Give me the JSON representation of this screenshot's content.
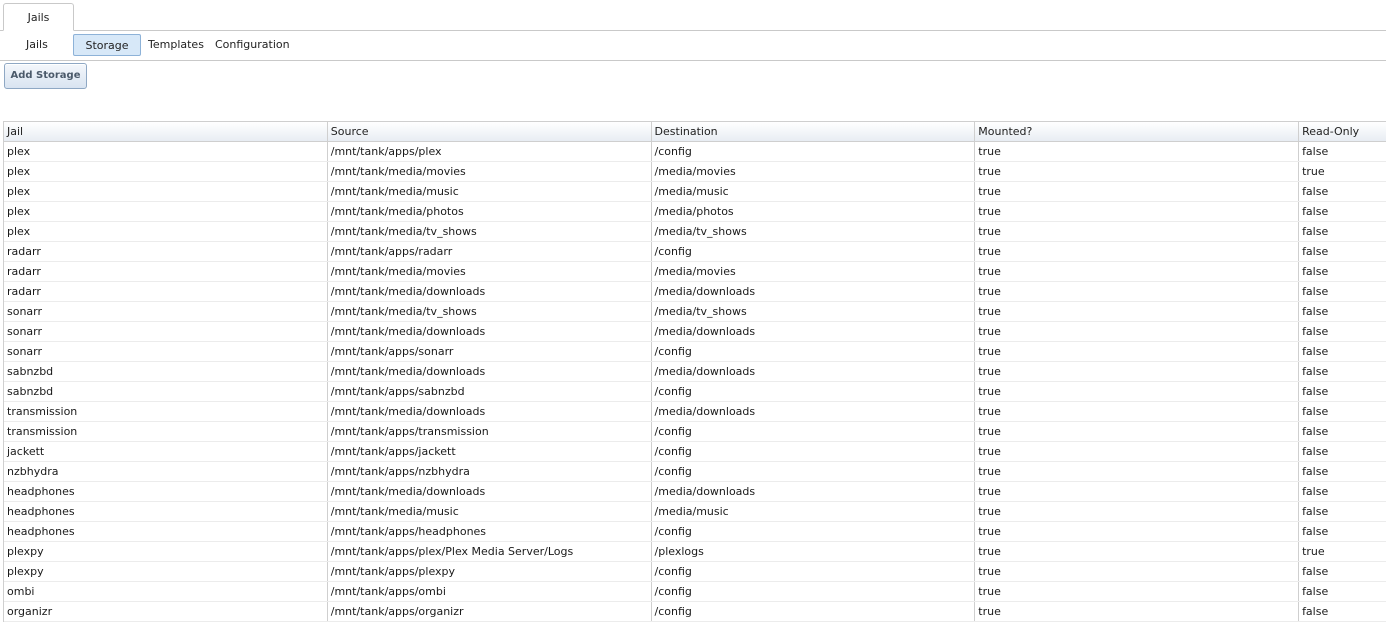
{
  "main_tabs": [
    {
      "label": "Jails"
    }
  ],
  "subnav": {
    "items": [
      "Jails",
      "Storage",
      "Templates",
      "Configuration"
    ],
    "active": "Storage"
  },
  "toolbar": {
    "add_storage_label": "Add Storage"
  },
  "table": {
    "columns": [
      "Jail",
      "Source",
      "Destination",
      "Mounted?",
      "Read-Only"
    ],
    "rows": [
      [
        "plex",
        "/mnt/tank/apps/plex",
        "/config",
        "true",
        "false"
      ],
      [
        "plex",
        "/mnt/tank/media/movies",
        "/media/movies",
        "true",
        "true"
      ],
      [
        "plex",
        "/mnt/tank/media/music",
        "/media/music",
        "true",
        "false"
      ],
      [
        "plex",
        "/mnt/tank/media/photos",
        "/media/photos",
        "true",
        "false"
      ],
      [
        "plex",
        "/mnt/tank/media/tv_shows",
        "/media/tv_shows",
        "true",
        "false"
      ],
      [
        "radarr",
        "/mnt/tank/apps/radarr",
        "/config",
        "true",
        "false"
      ],
      [
        "radarr",
        "/mnt/tank/media/movies",
        "/media/movies",
        "true",
        "false"
      ],
      [
        "radarr",
        "/mnt/tank/media/downloads",
        "/media/downloads",
        "true",
        "false"
      ],
      [
        "sonarr",
        "/mnt/tank/media/tv_shows",
        "/media/tv_shows",
        "true",
        "false"
      ],
      [
        "sonarr",
        "/mnt/tank/media/downloads",
        "/media/downloads",
        "true",
        "false"
      ],
      [
        "sonarr",
        "/mnt/tank/apps/sonarr",
        "/config",
        "true",
        "false"
      ],
      [
        "sabnzbd",
        "/mnt/tank/media/downloads",
        "/media/downloads",
        "true",
        "false"
      ],
      [
        "sabnzbd",
        "/mnt/tank/apps/sabnzbd",
        "/config",
        "true",
        "false"
      ],
      [
        "transmission",
        "/mnt/tank/media/downloads",
        "/media/downloads",
        "true",
        "false"
      ],
      [
        "transmission",
        "/mnt/tank/apps/transmission",
        "/config",
        "true",
        "false"
      ],
      [
        "jackett",
        "/mnt/tank/apps/jackett",
        "/config",
        "true",
        "false"
      ],
      [
        "nzbhydra",
        "/mnt/tank/apps/nzbhydra",
        "/config",
        "true",
        "false"
      ],
      [
        "headphones",
        "/mnt/tank/media/downloads",
        "/media/downloads",
        "true",
        "false"
      ],
      [
        "headphones",
        "/mnt/tank/media/music",
        "/media/music",
        "true",
        "false"
      ],
      [
        "headphones",
        "/mnt/tank/apps/headphones",
        "/config",
        "true",
        "false"
      ],
      [
        "plexpy",
        "/mnt/tank/apps/plex/Plex Media Server/Logs",
        "/plexlogs",
        "true",
        "true"
      ],
      [
        "plexpy",
        "/mnt/tank/apps/plexpy",
        "/config",
        "true",
        "false"
      ],
      [
        "ombi",
        "/mnt/tank/apps/ombi",
        "/config",
        "true",
        "false"
      ],
      [
        "organizr",
        "/mnt/tank/apps/organizr",
        "/config",
        "true",
        "false"
      ]
    ]
  },
  "colors": {
    "active_tab_bg": "#d7e8f8",
    "active_tab_border": "#8db2d8",
    "grid_border": "#cfcfcf",
    "header_gradient_bottom": "#e8edf3"
  }
}
